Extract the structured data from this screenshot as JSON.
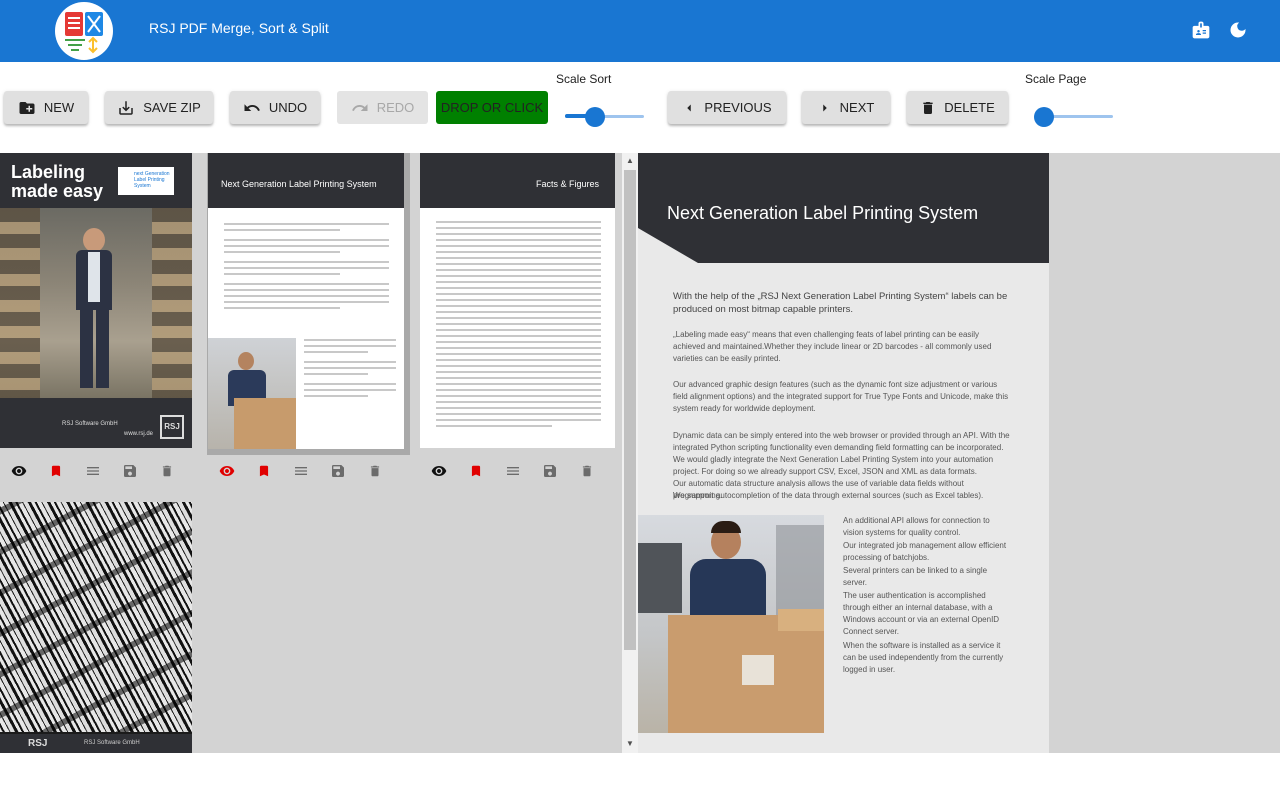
{
  "app": {
    "title": "RSJ PDF Merge, Sort & Split",
    "theme_accent": "#1976d2"
  },
  "header": {
    "icons": [
      "badge-icon",
      "dark-mode-icon"
    ]
  },
  "toolbar": {
    "new_label": "New",
    "save_zip_label": "Save ZIP",
    "undo_label": "Undo",
    "redo_label": "Redo",
    "drop_label": "Drop or click",
    "previous_label": "Previous",
    "next_label": "Next",
    "delete_label": "Delete",
    "scale_sort_label": "Scale Sort",
    "scale_page_label": "Scale Page",
    "scale_sort_value": 0.38,
    "scale_page_value": 0.1,
    "drop_color": "#008000"
  },
  "thumbnails": [
    {
      "cover_title_line1": "Labeling",
      "cover_title_line2": "made easy",
      "company": "RSJ Software GmbH",
      "website": "www.rsj.de",
      "logo_text": "RSJ",
      "badge": "next Generation Label Printing System",
      "selected": false,
      "bookmarked": true
    },
    {
      "title": "Next Generation Label Printing System",
      "selected": true,
      "bookmarked": true
    },
    {
      "title": "Facts & Figures",
      "selected": false,
      "bookmarked": true
    },
    {
      "company": "RSJ Software GmbH",
      "logo_text": "RSJ",
      "selected": false,
      "bookmarked": false
    }
  ],
  "preview": {
    "title": "Next Generation Label Printing System",
    "p1": "With the help of the „RSJ Next Generation Label Printing System“ labels can be produced on most bitmap capable printers.",
    "p2": "„Labeling made easy“ means that even challenging feats of label printing can be easily achieved and maintained.Whether they include linear or 2D barcodes - all commonly used varieties can be easily printed.",
    "p3": "Our advanced graphic design features (such as the dynamic font size adjustment or various field alignment options) and the integrated support for True Type Fonts and Unicode, make this system ready for worldwide deployment.",
    "p4": "Dynamic data can be simply entered into the web browser or provided through an API. With the integrated Python scripting functionality even demanding field formatting can be incorporated. We would gladly integrate the Next Generation Label Printing System into your automation project. For doing so we already support CSV, Excel, JSON and XML as data formats.",
    "p5": "Our automatic data structure analysis allows the use of variable data fields without programming.",
    "p6": "We support autocompletion of the data through external sources (such as Excel tables).",
    "c1": "An additional API allows for connection to vision systems for quality control.",
    "c2": "Our integrated job management allow efficient processing of batchjobs.",
    "c3": "Several printers can be linked to a single server.",
    "c4": "The user authentication is accomplished through either an internal database, with a Windows account or via an external OpenID Connect server.",
    "c5": "When the software is installed as a service it can be used independently from the currently logged in user."
  }
}
